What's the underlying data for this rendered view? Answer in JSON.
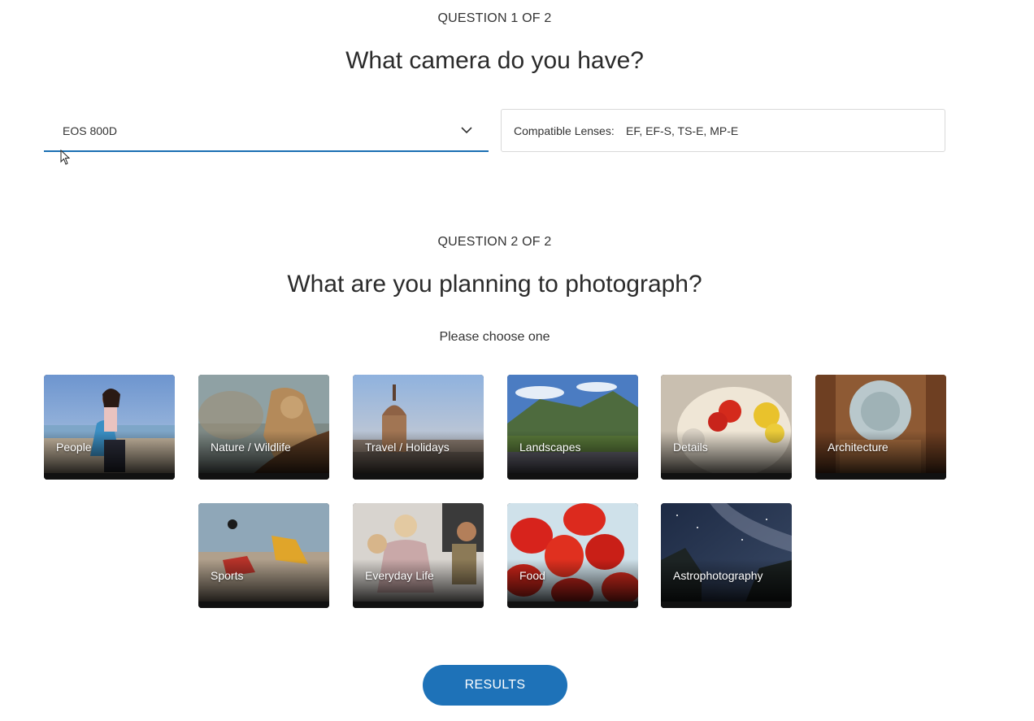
{
  "question1": {
    "eyebrow": "QUESTION 1 OF 2",
    "title": "What camera do you have?",
    "camera_select": {
      "value": "EOS 800D"
    },
    "compat": {
      "label": "Compatible Lenses:",
      "value": "EF, EF-S, TS-E, MP-E"
    }
  },
  "question2": {
    "eyebrow": "QUESTION 2 OF 2",
    "title": "What are you planning to photograph?",
    "subtitle": "Please choose one",
    "categories": [
      {
        "label": "People",
        "icon": "people-photo"
      },
      {
        "label": "Nature / Wildlife",
        "icon": "wildlife-photo"
      },
      {
        "label": "Travel / Holidays",
        "icon": "travel-photo"
      },
      {
        "label": "Landscapes",
        "icon": "landscape-photo"
      },
      {
        "label": "Details",
        "icon": "details-photo"
      },
      {
        "label": "Architecture",
        "icon": "architecture-photo"
      },
      {
        "label": "Sports",
        "icon": "sports-photo"
      },
      {
        "label": "Everyday Life",
        "icon": "everyday-photo"
      },
      {
        "label": "Food",
        "icon": "food-photo"
      },
      {
        "label": "Astrophotography",
        "icon": "astro-photo"
      }
    ]
  },
  "results_button": {
    "label": "RESULTS"
  },
  "colors": {
    "accent": "#1e72b8",
    "select_underline": "#1a6fb3",
    "text": "#333333"
  }
}
